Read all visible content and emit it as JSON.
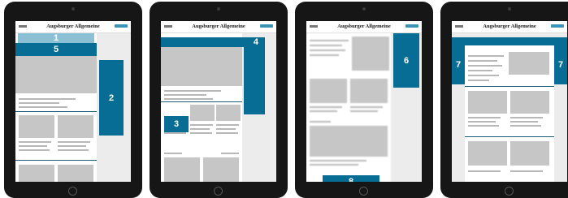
{
  "brand_title": "Augsburger Allgemeine",
  "colors": {
    "ad_blue": "#086d95",
    "ad_light": "#8cc1d5",
    "device": "#161616"
  },
  "ad_slots": {
    "t1_top": "1",
    "t1_banner": "5",
    "t1_right": "2",
    "t2_right": "4",
    "t2_inline": "3",
    "t3_right": "6",
    "t3_bottom": "8",
    "t4_left": "7",
    "t4_right": "7"
  }
}
